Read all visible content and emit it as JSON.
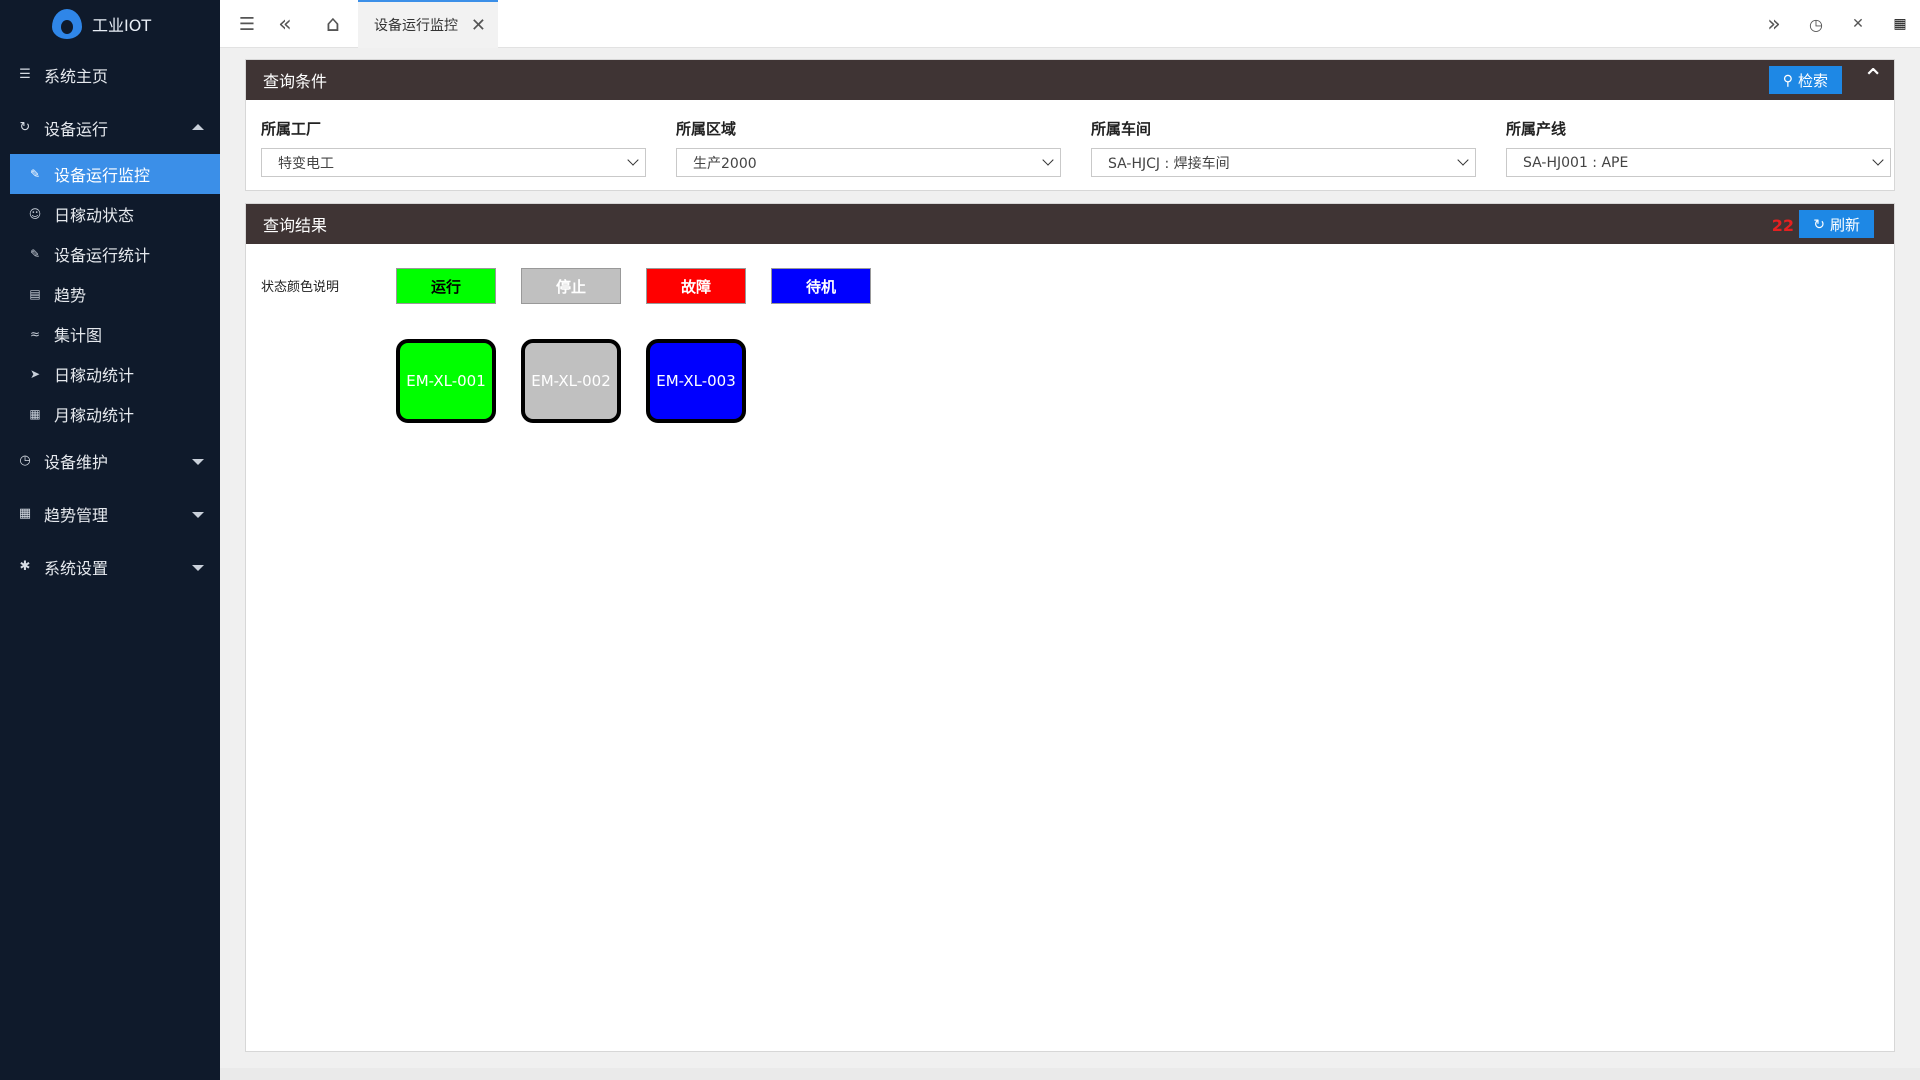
{
  "app": {
    "title": "工业IOT"
  },
  "sidebar": {
    "home": {
      "label": "系统主页",
      "icon": "layers-icon"
    },
    "groups": [
      {
        "label": "设备运行",
        "icon": "refresh-icon",
        "expanded": true,
        "items": [
          {
            "label": "设备运行监控",
            "icon": "edit-icon",
            "active": true
          },
          {
            "label": "日稼动状态",
            "icon": "smile-icon"
          },
          {
            "label": "设备运行统计",
            "icon": "edit-icon"
          },
          {
            "label": "趋势",
            "icon": "doc-icon"
          },
          {
            "label": "集计图",
            "icon": "pulse-icon"
          },
          {
            "label": "日稼动统计",
            "icon": "send-icon"
          },
          {
            "label": "月稼动统计",
            "icon": "list-icon"
          }
        ]
      },
      {
        "label": "设备维护",
        "icon": "clock-icon",
        "expanded": false
      },
      {
        "label": "趋势管理",
        "icon": "list-icon",
        "expanded": false
      },
      {
        "label": "系统设置",
        "icon": "gear-icon",
        "expanded": false
      }
    ]
  },
  "tabs": [
    {
      "label": "设备运行监控",
      "active": true
    }
  ],
  "query": {
    "title": "查询条件",
    "search_label": "检索",
    "fields": [
      {
        "label": "所属工厂",
        "value": "特变电工"
      },
      {
        "label": "所属区域",
        "value": "生产2000"
      },
      {
        "label": "所属车间",
        "value": "SA-HJCJ : 焊接车间"
      },
      {
        "label": "所属产线",
        "value": "SA-HJ001 : APE"
      }
    ]
  },
  "results": {
    "title": "查询结果",
    "refresh_count": "22",
    "refresh_label": "刷新",
    "legend_label": "状态颜色说明",
    "legend": [
      {
        "label": "运行",
        "color": "#00ff00",
        "text_color": "#000000"
      },
      {
        "label": "停止",
        "color": "#c0c0c0",
        "text_color": "#ffffff"
      },
      {
        "label": "故障",
        "color": "#ff0000",
        "text_color": "#ffffff"
      },
      {
        "label": "待机",
        "color": "#0000ff",
        "text_color": "#ffffff"
      }
    ],
    "equipment": [
      {
        "code": "EM-XL-001",
        "color": "#00ff00"
      },
      {
        "code": "EM-XL-002",
        "color": "#c0c0c0"
      },
      {
        "code": "EM-XL-003",
        "color": "#0000ff"
      }
    ]
  },
  "colors": {
    "sidebar_bg": "#0f1a2b",
    "accent": "#3b8fe8",
    "panel_header": "#3f3434",
    "alert": "#e52020"
  }
}
